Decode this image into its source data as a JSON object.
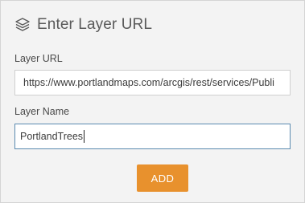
{
  "header": {
    "icon": "layers-icon",
    "title": "Enter Layer URL"
  },
  "form": {
    "layer_url_label": "Layer URL",
    "layer_url_value": "https://www.portlandmaps.com/arcgis/rest/services/Publi",
    "layer_name_label": "Layer Name",
    "layer_name_value": "PortlandTrees",
    "add_label": "ADD"
  },
  "colors": {
    "panel_background": "#f3f3f3",
    "accent_button": "#e8912d",
    "focused_border": "#5a8ab0"
  }
}
